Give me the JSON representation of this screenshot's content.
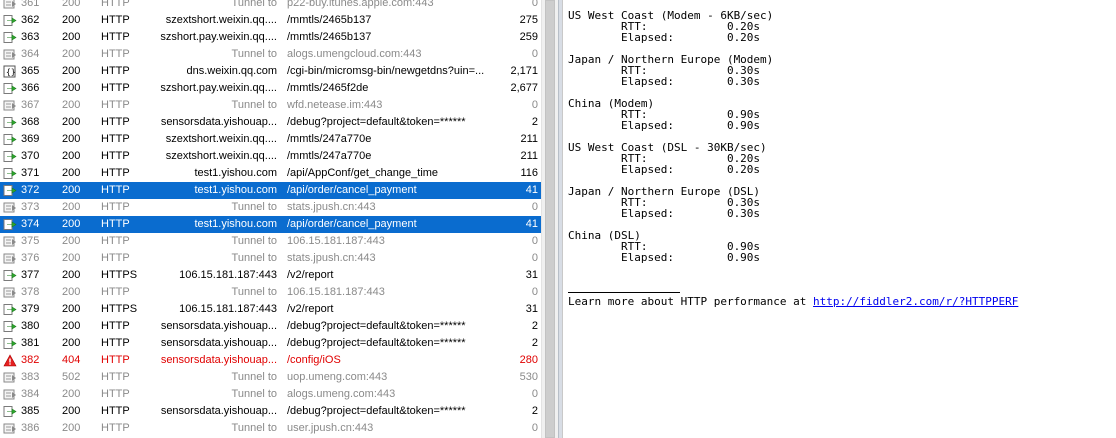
{
  "sessions": [
    {
      "num": "361",
      "result": "200",
      "protocol": "HTTP",
      "host": "Tunnel to",
      "url": "p22-buy.itunes.apple.com:443",
      "body": "0",
      "icon": "tunnel-icon",
      "style": "tunnel"
    },
    {
      "num": "362",
      "result": "200",
      "protocol": "HTTP",
      "host": "szextshort.weixin.qq....",
      "url": "/mmtls/2465b137",
      "body": "275",
      "icon": "response-arrow-icon",
      "style": "normal"
    },
    {
      "num": "363",
      "result": "200",
      "protocol": "HTTP",
      "host": "szshort.pay.weixin.qq....",
      "url": "/mmtls/2465b137",
      "body": "259",
      "icon": "response-arrow-icon",
      "style": "normal"
    },
    {
      "num": "364",
      "result": "200",
      "protocol": "HTTP",
      "host": "Tunnel to",
      "url": "alogs.umengcloud.com:443",
      "body": "0",
      "icon": "tunnel-icon",
      "style": "tunnel"
    },
    {
      "num": "365",
      "result": "200",
      "protocol": "HTTP",
      "host": "dns.weixin.qq.com",
      "url": "/cgi-bin/micromsg-bin/newgetdns?uin=...",
      "body": "2,171",
      "icon": "script-icon",
      "style": "normal"
    },
    {
      "num": "366",
      "result": "200",
      "protocol": "HTTP",
      "host": "szshort.pay.weixin.qq....",
      "url": "/mmtls/2465f2de",
      "body": "2,677",
      "icon": "response-arrow-icon",
      "style": "normal"
    },
    {
      "num": "367",
      "result": "200",
      "protocol": "HTTP",
      "host": "Tunnel to",
      "url": "wfd.netease.im:443",
      "body": "0",
      "icon": "tunnel-icon",
      "style": "tunnel"
    },
    {
      "num": "368",
      "result": "200",
      "protocol": "HTTP",
      "host": "sensorsdata.yishouap...",
      "url": "/debug?project=default&token=******",
      "body": "2",
      "icon": "response-arrow-icon",
      "style": "normal"
    },
    {
      "num": "369",
      "result": "200",
      "protocol": "HTTP",
      "host": "szextshort.weixin.qq....",
      "url": "/mmtls/247a770e",
      "body": "211",
      "icon": "response-arrow-icon",
      "style": "normal"
    },
    {
      "num": "370",
      "result": "200",
      "protocol": "HTTP",
      "host": "szextshort.weixin.qq....",
      "url": "/mmtls/247a770e",
      "body": "211",
      "icon": "response-arrow-icon",
      "style": "normal"
    },
    {
      "num": "371",
      "result": "200",
      "protocol": "HTTP",
      "host": "test1.yishou.com",
      "url": "/api/AppConf/get_change_time",
      "body": "116",
      "icon": "response-arrow-icon",
      "style": "normal"
    },
    {
      "num": "372",
      "result": "200",
      "protocol": "HTTP",
      "host": "test1.yishou.com",
      "url": "/api/order/cancel_payment",
      "body": "41",
      "icon": "response-arrow-icon",
      "style": "selected"
    },
    {
      "num": "373",
      "result": "200",
      "protocol": "HTTP",
      "host": "Tunnel to",
      "url": "stats.jpush.cn:443",
      "body": "0",
      "icon": "tunnel-icon",
      "style": "tunnel"
    },
    {
      "num": "374",
      "result": "200",
      "protocol": "HTTP",
      "host": "test1.yishou.com",
      "url": "/api/order/cancel_payment",
      "body": "41",
      "icon": "response-arrow-icon",
      "style": "selected"
    },
    {
      "num": "375",
      "result": "200",
      "protocol": "HTTP",
      "host": "Tunnel to",
      "url": "106.15.181.187:443",
      "body": "0",
      "icon": "tunnel-icon",
      "style": "tunnel"
    },
    {
      "num": "376",
      "result": "200",
      "protocol": "HTTP",
      "host": "Tunnel to",
      "url": "stats.jpush.cn:443",
      "body": "0",
      "icon": "tunnel-icon",
      "style": "tunnel"
    },
    {
      "num": "377",
      "result": "200",
      "protocol": "HTTPS",
      "host": "106.15.181.187:443",
      "url": "/v2/report",
      "body": "31",
      "icon": "response-arrow-icon",
      "style": "normal"
    },
    {
      "num": "378",
      "result": "200",
      "protocol": "HTTP",
      "host": "Tunnel to",
      "url": "106.15.181.187:443",
      "body": "0",
      "icon": "tunnel-icon",
      "style": "tunnel"
    },
    {
      "num": "379",
      "result": "200",
      "protocol": "HTTPS",
      "host": "106.15.181.187:443",
      "url": "/v2/report",
      "body": "31",
      "icon": "response-arrow-icon",
      "style": "normal"
    },
    {
      "num": "380",
      "result": "200",
      "protocol": "HTTP",
      "host": "sensorsdata.yishouap...",
      "url": "/debug?project=default&token=******",
      "body": "2",
      "icon": "response-arrow-icon",
      "style": "normal"
    },
    {
      "num": "381",
      "result": "200",
      "protocol": "HTTP",
      "host": "sensorsdata.yishouap...",
      "url": "/debug?project=default&token=******",
      "body": "2",
      "icon": "response-arrow-icon",
      "style": "normal"
    },
    {
      "num": "382",
      "result": "404",
      "protocol": "HTTP",
      "host": "sensorsdata.yishouap...",
      "url": "/config/iOS",
      "body": "280",
      "icon": "warning-icon",
      "style": "error"
    },
    {
      "num": "383",
      "result": "502",
      "protocol": "HTTP",
      "host": "Tunnel to",
      "url": "uop.umeng.com:443",
      "body": "530",
      "icon": "tunnel-icon",
      "style": "tunnel"
    },
    {
      "num": "384",
      "result": "200",
      "protocol": "HTTP",
      "host": "Tunnel to",
      "url": "alogs.umeng.com:443",
      "body": "0",
      "icon": "tunnel-icon",
      "style": "tunnel"
    },
    {
      "num": "385",
      "result": "200",
      "protocol": "HTTP",
      "host": "sensorsdata.yishouap...",
      "url": "/debug?project=default&token=******",
      "body": "2",
      "icon": "response-arrow-icon",
      "style": "normal"
    },
    {
      "num": "386",
      "result": "200",
      "protocol": "HTTP",
      "host": "Tunnel to",
      "url": "user.jpush.cn:443",
      "body": "0",
      "icon": "tunnel-icon",
      "style": "tunnel"
    }
  ],
  "perf": {
    "lines": [
      "US West Coast (Modem - 6KB/sec)",
      "        RTT:            0.20s",
      "        Elapsed:        0.20s",
      "",
      "Japan / Northern Europe (Modem)",
      "        RTT:            0.30s",
      "        Elapsed:        0.30s",
      "",
      "China (Modem)",
      "        RTT:            0.90s",
      "        Elapsed:        0.90s",
      "",
      "US West Coast (DSL - 30KB/sec)",
      "        RTT:            0.20s",
      "        Elapsed:        0.20s",
      "",
      "Japan / Northern Europe (DSL)",
      "        RTT:            0.30s",
      "        Elapsed:        0.30s",
      "",
      "China (DSL)",
      "        RTT:            0.90s",
      "        Elapsed:        0.90s"
    ],
    "learn_more": "Learn more about HTTP performance at ",
    "link": "http://fiddler2.com/r/?HTTPPERF"
  },
  "colors": {
    "selected_bg": "#0a6ccf",
    "tunnel_text": "#8a8a8a",
    "error_text": "#e00000",
    "link": "#0000ee"
  }
}
